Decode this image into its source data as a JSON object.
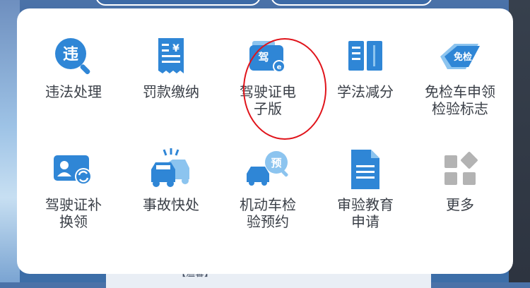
{
  "background": {
    "bottom_text": "【温馨】"
  },
  "services": {
    "row1": [
      {
        "label": "违法处理",
        "icon": "violation-search-icon",
        "glyph": "违"
      },
      {
        "label": "罚款缴纳",
        "icon": "fine-receipt-icon",
        "glyph": "¥"
      },
      {
        "label": "驾驶证电\n子版",
        "icon": "e-license-card-icon",
        "glyph": "驾"
      },
      {
        "label": "学法减分",
        "icon": "open-book-icon"
      },
      {
        "label": "免检车申领\n检验标志",
        "icon": "inspection-exempt-badge-icon",
        "glyph": "免检"
      }
    ],
    "row2": [
      {
        "label": "驾驶证补\n换领",
        "icon": "license-renew-icon"
      },
      {
        "label": "事故快处",
        "icon": "car-accident-icon"
      },
      {
        "label": "机动车检\n验预约",
        "icon": "vehicle-appointment-icon",
        "glyph": "预"
      },
      {
        "label": "审验教育\n申请",
        "icon": "document-icon"
      },
      {
        "label": "更多",
        "icon": "more-grid-icon"
      }
    ]
  },
  "colors": {
    "icon_blue": "#2f86d6",
    "icon_light": "#8cc4ef",
    "highlight_red": "#e0141b",
    "more_gray": "#b3b3b3"
  }
}
